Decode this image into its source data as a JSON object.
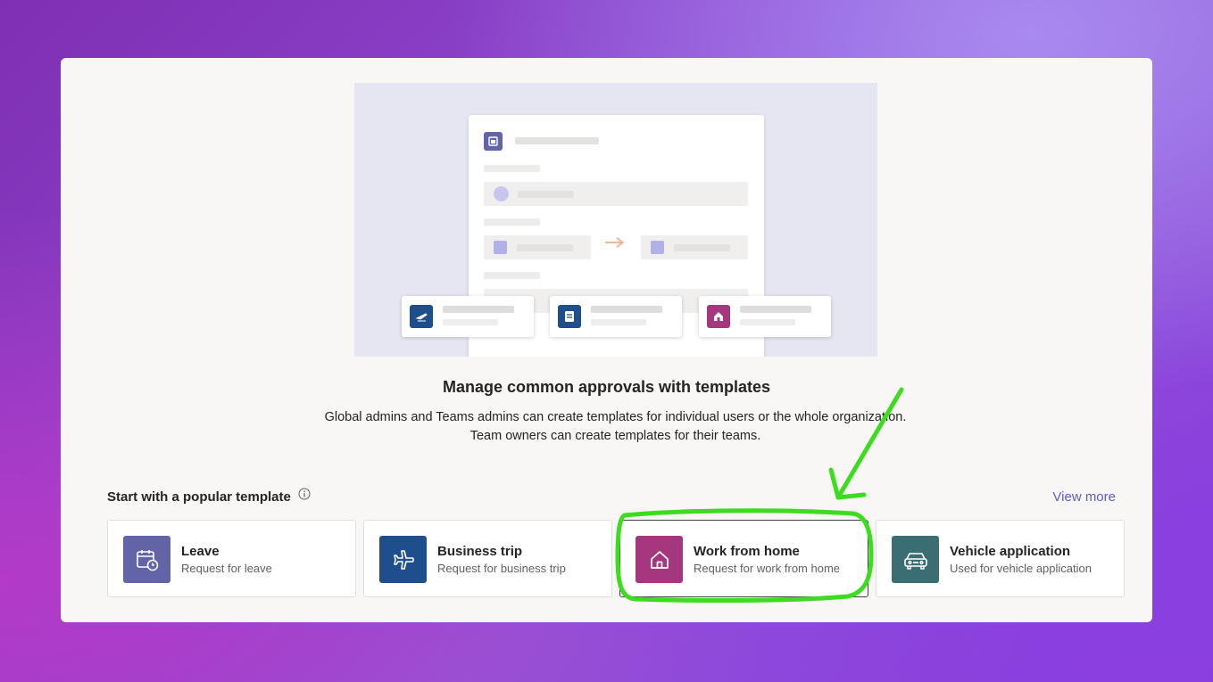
{
  "heading": "Manage common approvals with templates",
  "description": {
    "line1": "Global admins and Teams admins can create templates for individual users or the whole organization.",
    "line2": "Team owners can create templates for their teams."
  },
  "templates_section": {
    "title": "Start with a popular template",
    "view_more": "View more",
    "items": [
      {
        "title": "Leave",
        "subtitle": "Request for leave",
        "color": "#6264a7",
        "icon": "calendar-clock-icon"
      },
      {
        "title": "Business trip",
        "subtitle": "Request for business trip",
        "color": "#1e4e8c",
        "icon": "airplane-icon"
      },
      {
        "title": "Work from home",
        "subtitle": "Request for work from home",
        "color": "#a4377d",
        "icon": "home-icon"
      },
      {
        "title": "Vehicle application",
        "subtitle": "Used for vehicle application",
        "color": "#3b6e73",
        "icon": "car-icon"
      }
    ]
  },
  "colors": {
    "accent": "#5b5fc7",
    "annotation": "#3ddc1f"
  }
}
